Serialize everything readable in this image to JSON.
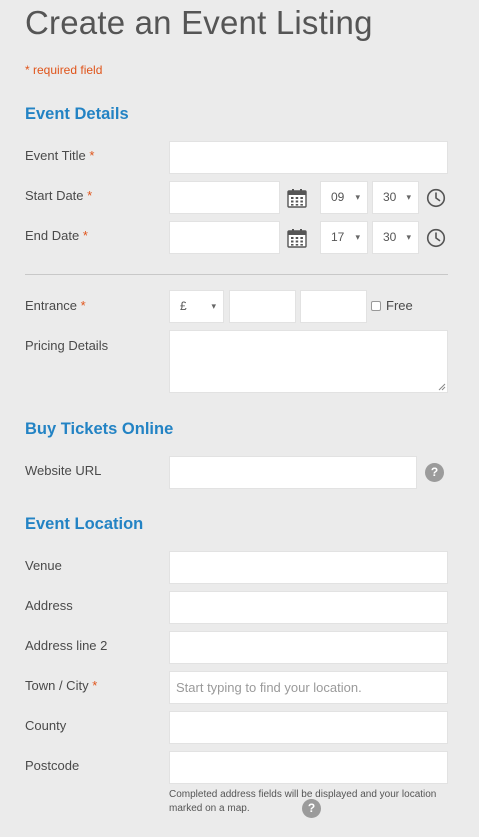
{
  "page_title": "Create an Event Listing",
  "required_note": "* required field",
  "required_star": "*",
  "sections": {
    "event_details": "Event Details",
    "buy_tickets": "Buy Tickets Online",
    "event_location": "Event Location"
  },
  "labels": {
    "event_title": "Event Title",
    "start_date": "Start Date",
    "end_date": "End Date",
    "entrance": "Entrance",
    "pricing_details": "Pricing Details",
    "website_url": "Website URL",
    "venue": "Venue",
    "address": "Address",
    "address2": "Address line 2",
    "town_city": "Town / City",
    "county": "County",
    "postcode": "Postcode"
  },
  "start_time": {
    "hour": "09",
    "minute": "30"
  },
  "end_time": {
    "hour": "17",
    "minute": "30"
  },
  "currency": "£",
  "caret": "▾",
  "free_label": "Free",
  "help_glyph": "?",
  "town_placeholder": "Start typing to find your location.",
  "address_note": "Completed address fields will be displayed and your location marked on a map.",
  "colors": {
    "accent": "#2383c4",
    "required": "#e0541a",
    "background": "#ebebeb"
  },
  "icons": {
    "calendar": "calendar-icon",
    "clock": "clock-icon",
    "help": "help-icon"
  }
}
